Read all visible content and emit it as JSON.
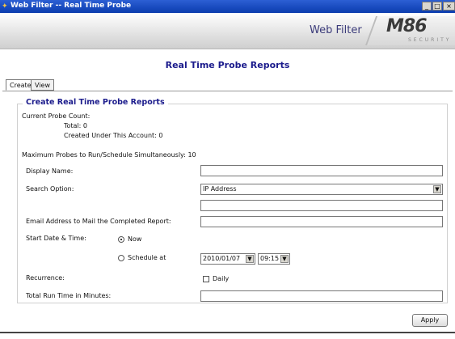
{
  "window": {
    "title": "Web Filter -- Real Time Probe",
    "icon": "app-icon",
    "controls": [
      "minimize-icon",
      "maximize-icon",
      "close-icon"
    ]
  },
  "header": {
    "product_name": "Web Filter",
    "logo_main": "M86",
    "logo_sub": "SECURITY"
  },
  "page": {
    "title": "Real Time Probe Reports"
  },
  "tabs": [
    {
      "label": "Create",
      "active": true
    },
    {
      "label": "View",
      "active": false
    }
  ],
  "form": {
    "legend": "Create Real Time Probe Reports",
    "probe_count_label": "Current Probe Count:",
    "total": "Total: 0",
    "created_under_account": "Created Under This Account: 0",
    "max_probes": "Maximum Probes to Run/Schedule Simultaneously: 10",
    "display_name_label": "Display Name:",
    "display_name_value": "",
    "search_option_label": "Search Option:",
    "search_option_value": "IP Address",
    "search_value": "",
    "email_label": "Email Address to Mail the Completed Report:",
    "email_value": "",
    "start_label": "Start Date & Time:",
    "now_label": "Now",
    "now_checked": true,
    "schedule_label": "Schedule at",
    "schedule_checked": false,
    "date_value": "2010/01/07",
    "time_value": "09:15",
    "recurrence_label": "Recurrence:",
    "daily_label": "Daily",
    "daily_checked": false,
    "total_run_time_label": "Total Run Time in Minutes:",
    "total_run_time_value": "",
    "apply_label": "Apply"
  }
}
